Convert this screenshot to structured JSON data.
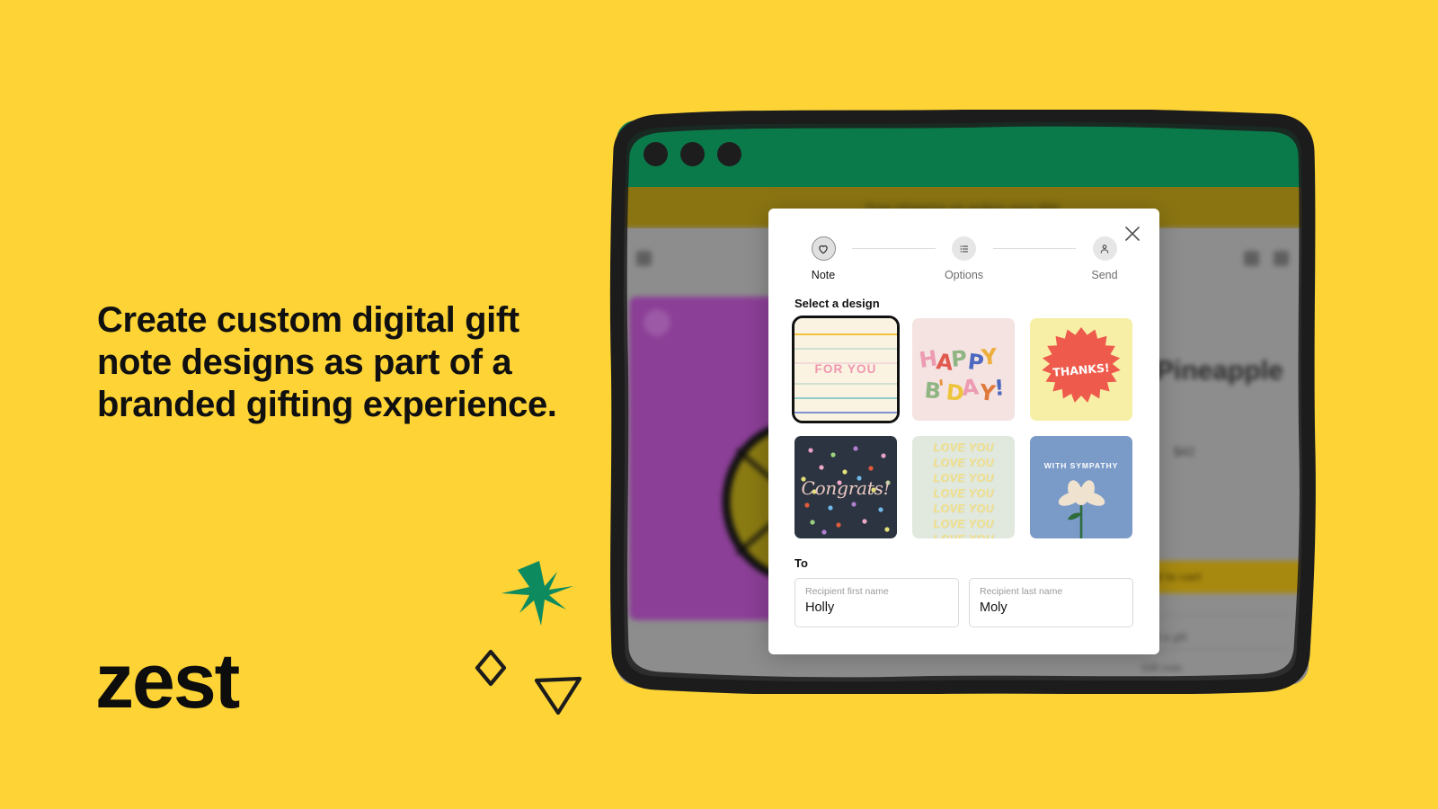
{
  "brand": {
    "wordmark": "zest",
    "background_color": "#FDD335",
    "accent_green": "#0B7A4B"
  },
  "marketing": {
    "headline": "Create custom digital gift note designs as part of a branded gifting experience."
  },
  "decorations": [
    {
      "name": "star",
      "color": "#0E8A5F"
    },
    {
      "name": "diamond",
      "color": "#1C1C1C"
    },
    {
      "name": "triangle",
      "color": "#1C1C1C"
    }
  ],
  "browser": {
    "titlebar_color": "#0B7A4B",
    "dots": 3,
    "announcement_text": "Free shipping on orders over $50",
    "page": {
      "product_title": "Pineapple",
      "price": "$42",
      "cta_label": "Add to cart",
      "option_row_1": "Add a gift",
      "option_row_2": "Gift note"
    }
  },
  "modal": {
    "close_icon": "close-icon",
    "steps": [
      {
        "label": "Note",
        "icon": "heart-icon",
        "state": "active"
      },
      {
        "label": "Options",
        "icon": "list-icon",
        "state": "upcoming"
      },
      {
        "label": "Send",
        "icon": "person-icon",
        "state": "upcoming"
      }
    ],
    "design_section": {
      "title": "Select a design",
      "designs": [
        {
          "id": "for-you",
          "label": "FOR YOU",
          "selected": true,
          "bg": "#FBF3E2",
          "text_color": "#F096AE"
        },
        {
          "id": "happy-bday",
          "label": "HAPPY B'DAY!",
          "selected": false,
          "bg": "#F4E3E1"
        },
        {
          "id": "thanks",
          "label": "THANKS!",
          "selected": false,
          "bg": "#F7EFA6",
          "burst_color": "#EE5B4C"
        },
        {
          "id": "congrats",
          "label": "Congrats!",
          "selected": false,
          "bg": "#2B3440",
          "text_color": "#EBC8C2"
        },
        {
          "id": "love-you",
          "label": "LOVE YOU",
          "selected": false,
          "bg": "#E1E9DE",
          "text_color": "#F4E08A",
          "repeat": 6
        },
        {
          "id": "with-sympathy",
          "label": "WITH SYMPATHY",
          "selected": false,
          "bg": "#7A9AC8",
          "text_color": "#FFFFFF"
        }
      ]
    },
    "to_section": {
      "title": "To",
      "fields": [
        {
          "id": "first-name",
          "label": "Recipient first name",
          "value": "Holly"
        },
        {
          "id": "last-name",
          "label": "Recipient last name",
          "value": "Moly"
        }
      ]
    }
  }
}
